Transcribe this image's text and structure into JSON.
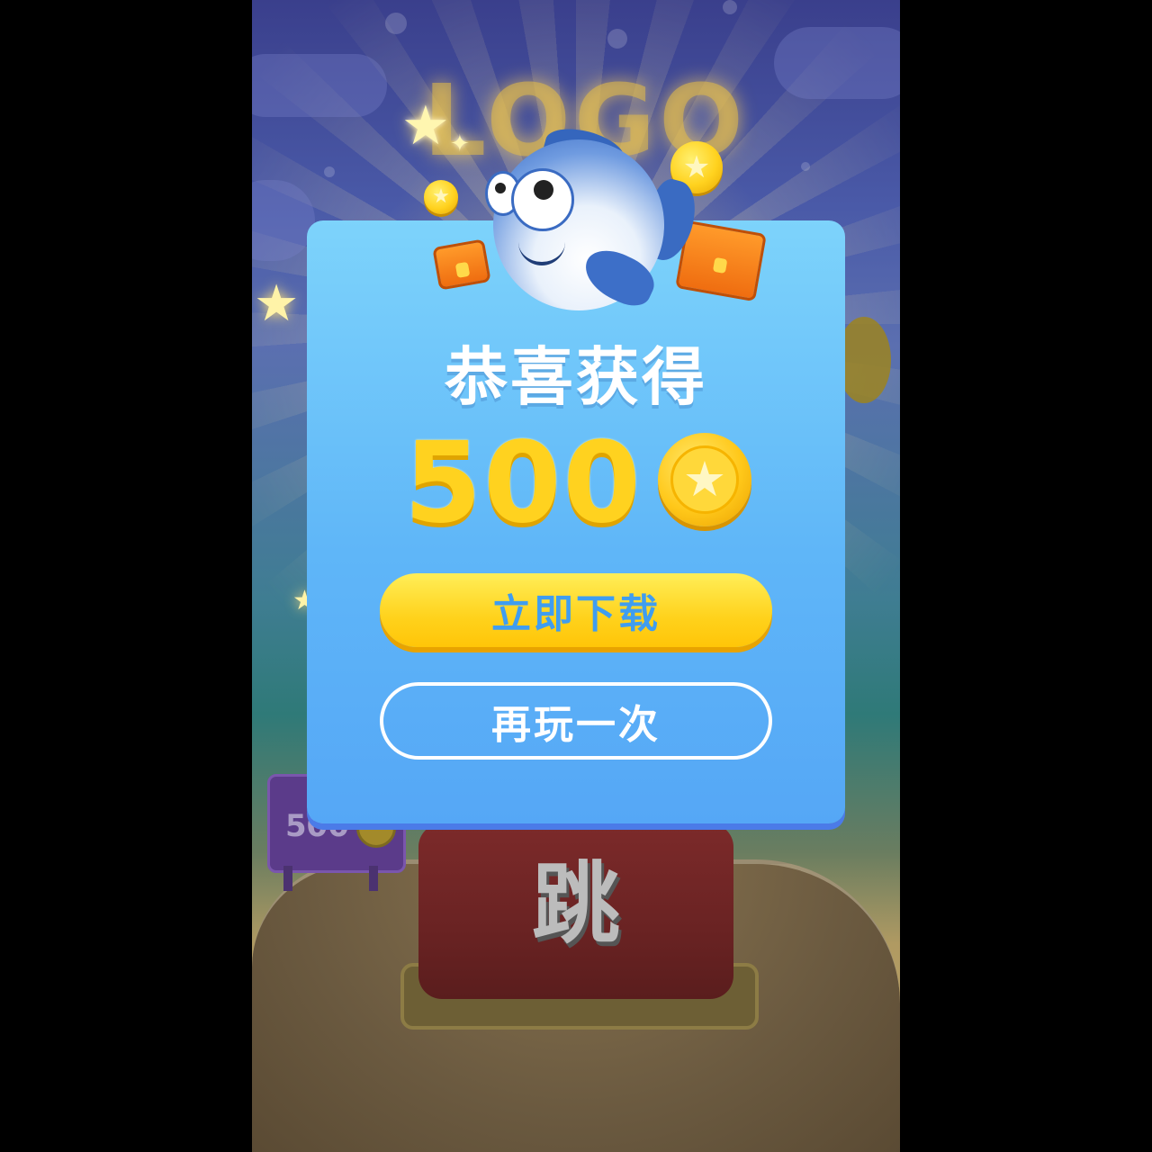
{
  "background": {
    "logo_text": "LOGO",
    "sign_value": "500",
    "jump_button_label": "跳"
  },
  "dialog": {
    "title": "恭喜获得",
    "reward_amount": "500",
    "download_button_label": "立即下载",
    "replay_button_label": "再玩一次"
  },
  "icons": {
    "coin": "star-coin-icon",
    "chest": "treasure-chest-icon",
    "mascot": "pufferfish-mascot",
    "star": "star-icon"
  },
  "colors": {
    "card_top": "#7dd3fb",
    "card_bottom": "#55a7f6",
    "primary_button": "#ffd21c",
    "primary_button_text": "#3f9df0",
    "reward_text": "#ffd21f"
  }
}
